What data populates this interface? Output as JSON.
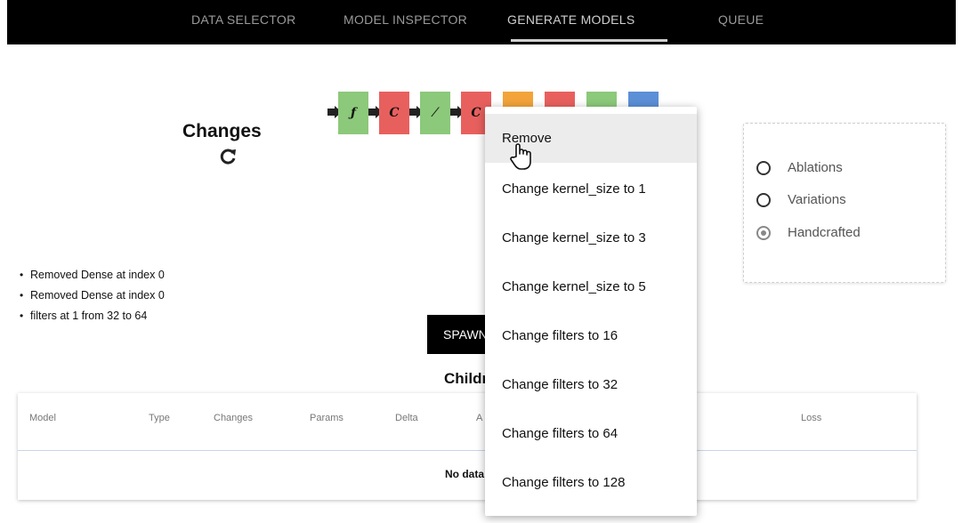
{
  "nav": {
    "tabs": [
      "DATA SELECTOR",
      "MODEL INSPECTOR",
      "GENERATE MODELS",
      "QUEUE"
    ],
    "active_tab": "GENERATE MODELS"
  },
  "changes": {
    "title": "Changes",
    "items": [
      "Removed Dense at index 0",
      "Removed Dense at index 0",
      "filters at 1 from 32 to 64"
    ]
  },
  "pipeline": {
    "blocks": [
      {
        "glyph": "ƒ",
        "color": "#8cc97a"
      },
      {
        "glyph": "C",
        "color": "#e8605e"
      },
      {
        "glyph": "⁄",
        "color": "#8cc97a"
      },
      {
        "glyph": "C",
        "color": "#e8605e"
      },
      {
        "glyph": "",
        "color": "#f2a43a"
      },
      {
        "glyph": "",
        "color": "#e8605e"
      },
      {
        "glyph": "",
        "color": "#8cc97a"
      },
      {
        "glyph": "",
        "color": "#5b8fd6"
      }
    ]
  },
  "menu": {
    "items": [
      "Remove",
      "Change kernel_size to 1",
      "Change kernel_size to 3",
      "Change kernel_size to 5",
      "Change filters to 16",
      "Change filters to 32",
      "Change filters to 64",
      "Change filters to 128"
    ],
    "hovered": "Remove"
  },
  "mode": {
    "options": [
      "Ablations",
      "Variations",
      "Handcrafted"
    ],
    "selected": "Handcrafted"
  },
  "spawn": {
    "label": "SPAWN"
  },
  "children": {
    "title": "Children",
    "columns": [
      "Model",
      "Type",
      "Changes",
      "Params",
      "Delta",
      "A",
      "",
      "Loss"
    ],
    "empty_text": "No data"
  }
}
